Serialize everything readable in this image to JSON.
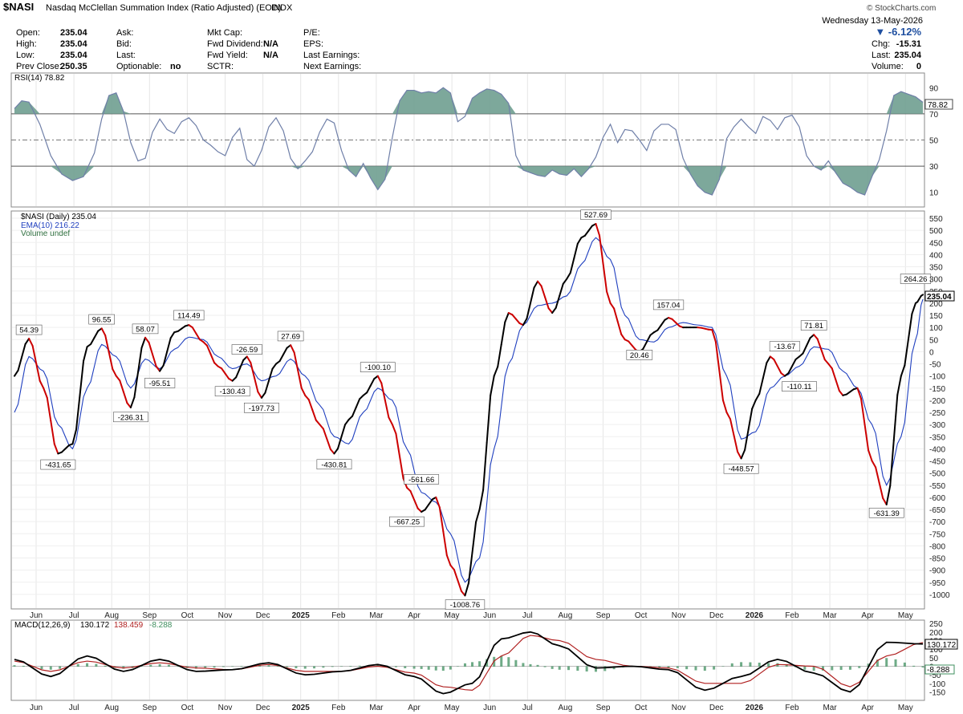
{
  "header": {
    "symbol": "$NASI",
    "name": "Nasdaq McClellan Summation Index (Ratio Adjusted) (EOD)",
    "exchange": "INDX",
    "copyright": "© StockCharts.com",
    "date": "Wednesday 13-May-2026",
    "change_pct": "▼ -6.12%",
    "fields": [
      {
        "label": "Open:",
        "value": "235.04"
      },
      {
        "label": "High:",
        "value": "235.04"
      },
      {
        "label": "Low:",
        "value": "235.04"
      },
      {
        "label": "Prev Close:",
        "value": "250.35"
      },
      {
        "label": "Ask:",
        "value": ""
      },
      {
        "label": "Bid:",
        "value": ""
      },
      {
        "label": "Last:",
        "value": ""
      },
      {
        "label": "Optionable:",
        "value": "no"
      },
      {
        "label": "Mkt Cap:",
        "value": ""
      },
      {
        "label": "Fwd Dividend:",
        "value": "N/A"
      },
      {
        "label": "Fwd Yield:",
        "value": "N/A"
      },
      {
        "label": "SCTR:",
        "value": ""
      },
      {
        "label": "P/E:",
        "value": ""
      },
      {
        "label": "EPS:",
        "value": ""
      },
      {
        "label": "Last Earnings:",
        "value": ""
      },
      {
        "label": "Next Earnings:",
        "value": ""
      }
    ],
    "right_fields": [
      {
        "label": "Chg:",
        "value": "-15.31"
      },
      {
        "label": "Last:",
        "value": "235.04"
      },
      {
        "label": "Volume:",
        "value": "0"
      }
    ]
  },
  "colors": {
    "up": "#000000",
    "down": "#cc0000",
    "ema": "#1f3fbf",
    "rsi_fill": "#6f9f90",
    "macd_signal": "#b02020",
    "hist": "#3f8f5f"
  },
  "chart_data": [
    {
      "type": "line",
      "panel": "rsi",
      "legend": "RSI(14) 78.82",
      "last_value": "78.82",
      "ylim": [
        0,
        100
      ],
      "yticks": [
        90,
        70,
        50,
        30,
        10
      ],
      "guides": [
        70,
        50,
        30
      ],
      "x": [
        0,
        4,
        12,
        20,
        28,
        36,
        44,
        52,
        60,
        68,
        76,
        84,
        92,
        100,
        108,
        116,
        124,
        132,
        140,
        148,
        156,
        164,
        172,
        180,
        188,
        196,
        204,
        212,
        220,
        228,
        236,
        244,
        250
      ],
      "values": [
        74,
        79,
        50,
        22,
        40,
        85,
        70,
        35,
        64,
        50,
        70,
        40,
        52,
        30,
        62,
        60,
        30,
        45,
        60,
        28,
        20,
        40,
        75,
        80,
        85,
        88,
        58,
        72,
        86,
        80,
        42,
        32,
        60
      ],
      "series_full": [
        [
          0,
          74
        ],
        [
          2,
          80
        ],
        [
          4,
          79
        ],
        [
          7,
          62
        ],
        [
          10,
          38
        ],
        [
          13,
          24
        ],
        [
          16,
          19
        ],
        [
          19,
          22
        ],
        [
          22,
          40
        ],
        [
          24,
          66
        ],
        [
          26,
          84
        ],
        [
          28,
          86
        ],
        [
          30,
          72
        ],
        [
          32,
          48
        ],
        [
          34,
          34
        ],
        [
          36,
          36
        ],
        [
          38,
          56
        ],
        [
          40,
          66
        ],
        [
          42,
          58
        ],
        [
          44,
          55
        ],
        [
          46,
          64
        ],
        [
          48,
          67
        ],
        [
          50,
          61
        ],
        [
          52,
          50
        ],
        [
          54,
          46
        ],
        [
          56,
          41
        ],
        [
          58,
          38
        ],
        [
          60,
          52
        ],
        [
          62,
          59
        ],
        [
          64,
          35
        ],
        [
          66,
          30
        ],
        [
          68,
          42
        ],
        [
          70,
          60
        ],
        [
          72,
          67
        ],
        [
          74,
          57
        ],
        [
          76,
          36
        ],
        [
          78,
          28
        ],
        [
          80,
          34
        ],
        [
          82,
          41
        ],
        [
          84,
          56
        ],
        [
          86,
          66
        ],
        [
          88,
          63
        ],
        [
          90,
          42
        ],
        [
          92,
          27
        ],
        [
          94,
          22
        ],
        [
          96,
          32
        ],
        [
          98,
          21
        ],
        [
          100,
          12
        ],
        [
          102,
          20
        ],
        [
          104,
          52
        ],
        [
          106,
          80
        ],
        [
          108,
          88
        ],
        [
          110,
          88
        ],
        [
          112,
          86
        ],
        [
          114,
          87
        ],
        [
          116,
          86
        ],
        [
          118,
          90
        ],
        [
          120,
          86
        ],
        [
          122,
          64
        ],
        [
          124,
          68
        ],
        [
          126,
          82
        ],
        [
          128,
          86
        ],
        [
          130,
          89
        ],
        [
          132,
          88
        ],
        [
          134,
          85
        ],
        [
          136,
          78
        ],
        [
          138,
          38
        ],
        [
          140,
          27
        ],
        [
          142,
          25
        ],
        [
          144,
          23
        ],
        [
          146,
          22
        ],
        [
          148,
          27
        ],
        [
          150,
          24
        ],
        [
          152,
          23
        ],
        [
          154,
          28
        ],
        [
          156,
          22
        ],
        [
          158,
          28
        ],
        [
          160,
          37
        ],
        [
          162,
          52
        ],
        [
          164,
          62
        ],
        [
          166,
          48
        ],
        [
          168,
          58
        ],
        [
          170,
          57
        ],
        [
          172,
          50
        ],
        [
          174,
          42
        ],
        [
          176,
          57
        ],
        [
          178,
          62
        ],
        [
          180,
          62
        ],
        [
          182,
          58
        ],
        [
          184,
          36
        ],
        [
          186,
          24
        ],
        [
          188,
          15
        ],
        [
          190,
          10
        ],
        [
          192,
          8
        ],
        [
          194,
          20
        ],
        [
          196,
          51
        ],
        [
          198,
          60
        ],
        [
          200,
          66
        ],
        [
          202,
          60
        ],
        [
          204,
          55
        ],
        [
          206,
          68
        ],
        [
          208,
          65
        ],
        [
          210,
          58
        ],
        [
          212,
          67
        ],
        [
          214,
          69
        ],
        [
          216,
          60
        ],
        [
          218,
          38
        ],
        [
          220,
          30
        ],
        [
          222,
          27
        ],
        [
          224,
          34
        ],
        [
          226,
          25
        ],
        [
          228,
          17
        ],
        [
          230,
          14
        ],
        [
          232,
          10
        ],
        [
          234,
          8
        ],
        [
          236,
          22
        ],
        [
          238,
          35
        ],
        [
          240,
          57
        ],
        [
          242,
          84
        ],
        [
          244,
          87
        ],
        [
          246,
          85
        ],
        [
          248,
          83
        ],
        [
          250,
          78.82
        ]
      ]
    },
    {
      "type": "line",
      "panel": "price",
      "legend": [
        "$NASI (Daily) 235.04",
        "EMA(10) 216.22",
        "Volume undef"
      ],
      "ylim": [
        -1050,
        570
      ],
      "yticks": [
        550,
        500,
        450,
        400,
        350,
        300,
        250,
        200,
        150,
        100,
        50,
        0,
        -50,
        -100,
        -150,
        -200,
        -250,
        -300,
        -350,
        -400,
        -450,
        -500,
        -550,
        -600,
        -650,
        -700,
        -750,
        -800,
        -850,
        -900,
        -950,
        -1000
      ],
      "last_value": "235.04",
      "x_labels": [
        "Jun",
        "Jul",
        "Aug",
        "Sep",
        "Oct",
        "Nov",
        "Dec",
        "2025",
        "Feb",
        "Mar",
        "Apr",
        "May",
        "Jun",
        "Jul",
        "Aug",
        "Sep",
        "Oct",
        "Nov",
        "Dec",
        "2026",
        "Feb",
        "Mar",
        "Apr",
        "May"
      ],
      "series": [
        {
          "name": "$NASI",
          "x": [
            0,
            4,
            8,
            12,
            16,
            20,
            24,
            28,
            32,
            36,
            40,
            44,
            48,
            52,
            56,
            60,
            64,
            68,
            72,
            76,
            80,
            84,
            88,
            92,
            96,
            100,
            104,
            108,
            112,
            116,
            120,
            124,
            128,
            132,
            136,
            140,
            144,
            148,
            152,
            156,
            160,
            164,
            168,
            172,
            176,
            180,
            184,
            188,
            192,
            196,
            200,
            204,
            208,
            212,
            216,
            220,
            224,
            228,
            232,
            236,
            240,
            244,
            248,
            250
          ],
          "values": [
            -100,
            54,
            -150,
            -420,
            -380,
            20,
            96,
            -100,
            -230,
            58,
            -80,
            80,
            110,
            40,
            -60,
            -120,
            -20,
            -190,
            -50,
            27,
            -180,
            -300,
            -420,
            -280,
            -180,
            -100,
            -300,
            -560,
            -660,
            -600,
            -880,
            -1005,
            -650,
            -100,
            160,
            110,
            290,
            160,
            300,
            470,
            527,
            200,
            50,
            0,
            80,
            140,
            100,
            100,
            90,
            -250,
            -440,
            -200,
            -20,
            -100,
            -20,
            70,
            -50,
            -180,
            -150,
            -450,
            -630,
            -100,
            200,
            235.04
          ]
        },
        {
          "name": "EMA(10)",
          "x": [
            0,
            4,
            8,
            12,
            16,
            20,
            24,
            28,
            32,
            36,
            40,
            44,
            48,
            52,
            56,
            60,
            64,
            68,
            72,
            76,
            80,
            84,
            88,
            92,
            96,
            100,
            104,
            108,
            112,
            116,
            120,
            124,
            128,
            132,
            136,
            140,
            144,
            148,
            152,
            156,
            160,
            164,
            168,
            172,
            176,
            180,
            184,
            188,
            192,
            196,
            200,
            204,
            208,
            212,
            216,
            220,
            224,
            228,
            232,
            236,
            240,
            244,
            248,
            250
          ],
          "values": [
            -250,
            -20,
            -80,
            -300,
            -400,
            -150,
            30,
            -20,
            -150,
            -30,
            -70,
            10,
            60,
            50,
            -20,
            -70,
            -50,
            -120,
            -100,
            -30,
            -100,
            -220,
            -350,
            -380,
            -250,
            -150,
            -200,
            -400,
            -580,
            -620,
            -750,
            -950,
            -850,
            -400,
            -50,
            110,
            190,
            200,
            230,
            360,
            470,
            380,
            150,
            50,
            40,
            100,
            120,
            110,
            100,
            -100,
            -360,
            -330,
            -150,
            -100,
            -60,
            20,
            10,
            -80,
            -150,
            -300,
            -550,
            -350,
            50,
            216.22
          ]
        }
      ],
      "annotations": [
        {
          "label": "54.39"
        },
        {
          "label": "-431.65"
        },
        {
          "label": "96.55"
        },
        {
          "label": "-236.31"
        },
        {
          "label": "58.07"
        },
        {
          "label": "-95.51"
        },
        {
          "label": "114.49"
        },
        {
          "label": "-130.43"
        },
        {
          "label": "-26.59"
        },
        {
          "label": "-197.73"
        },
        {
          "label": "27.69"
        },
        {
          "label": "-430.81"
        },
        {
          "label": "-100.10"
        },
        {
          "label": "-561.66"
        },
        {
          "label": "-667.25"
        },
        {
          "label": "-1008.76"
        },
        {
          "label": "527.69"
        },
        {
          "label": "20.46"
        },
        {
          "label": "157.04"
        },
        {
          "label": "-448.57"
        },
        {
          "label": "-13.67"
        },
        {
          "label": "-110.11"
        },
        {
          "label": "71.81"
        },
        {
          "label": "-631.39"
        },
        {
          "label": "264.26"
        }
      ]
    },
    {
      "type": "line",
      "panel": "macd",
      "legend": [
        "MACD(12,26,9)",
        "130.172",
        "138.459",
        "-8.288"
      ],
      "ylim": [
        -190,
        260
      ],
      "yticks": [
        250,
        200,
        150,
        100,
        50,
        0,
        -50,
        -100,
        -150
      ],
      "last_values": [
        "130.172",
        "-8.288"
      ],
      "series": [
        {
          "name": "MACD",
          "x": [
            0,
            10,
            20,
            30,
            40,
            50,
            60,
            70,
            80,
            90,
            100,
            110,
            118,
            126,
            134,
            142,
            150,
            160,
            170,
            180,
            190,
            200,
            210,
            220,
            230,
            240,
            250
          ],
          "values": [
            40,
            -60,
            60,
            -30,
            40,
            -30,
            -20,
            20,
            -50,
            -30,
            10,
            -60,
            -160,
            -100,
            160,
            200,
            120,
            -10,
            0,
            -20,
            -140,
            -60,
            40,
            -40,
            -150,
            140,
            130.172
          ]
        },
        {
          "name": "Signal",
          "x": [
            0,
            10,
            20,
            30,
            40,
            50,
            60,
            70,
            80,
            90,
            100,
            110,
            118,
            126,
            134,
            142,
            150,
            160,
            170,
            180,
            190,
            200,
            210,
            220,
            230,
            240,
            250
          ],
          "values": [
            30,
            -30,
            30,
            -10,
            20,
            -10,
            -20,
            10,
            -30,
            -30,
            0,
            -40,
            -120,
            -140,
            60,
            180,
            150,
            40,
            0,
            -10,
            -100,
            -100,
            10,
            0,
            -120,
            60,
            138.459
          ]
        },
        {
          "name": "Histogram",
          "values_note": "MACD minus Signal"
        }
      ]
    }
  ]
}
